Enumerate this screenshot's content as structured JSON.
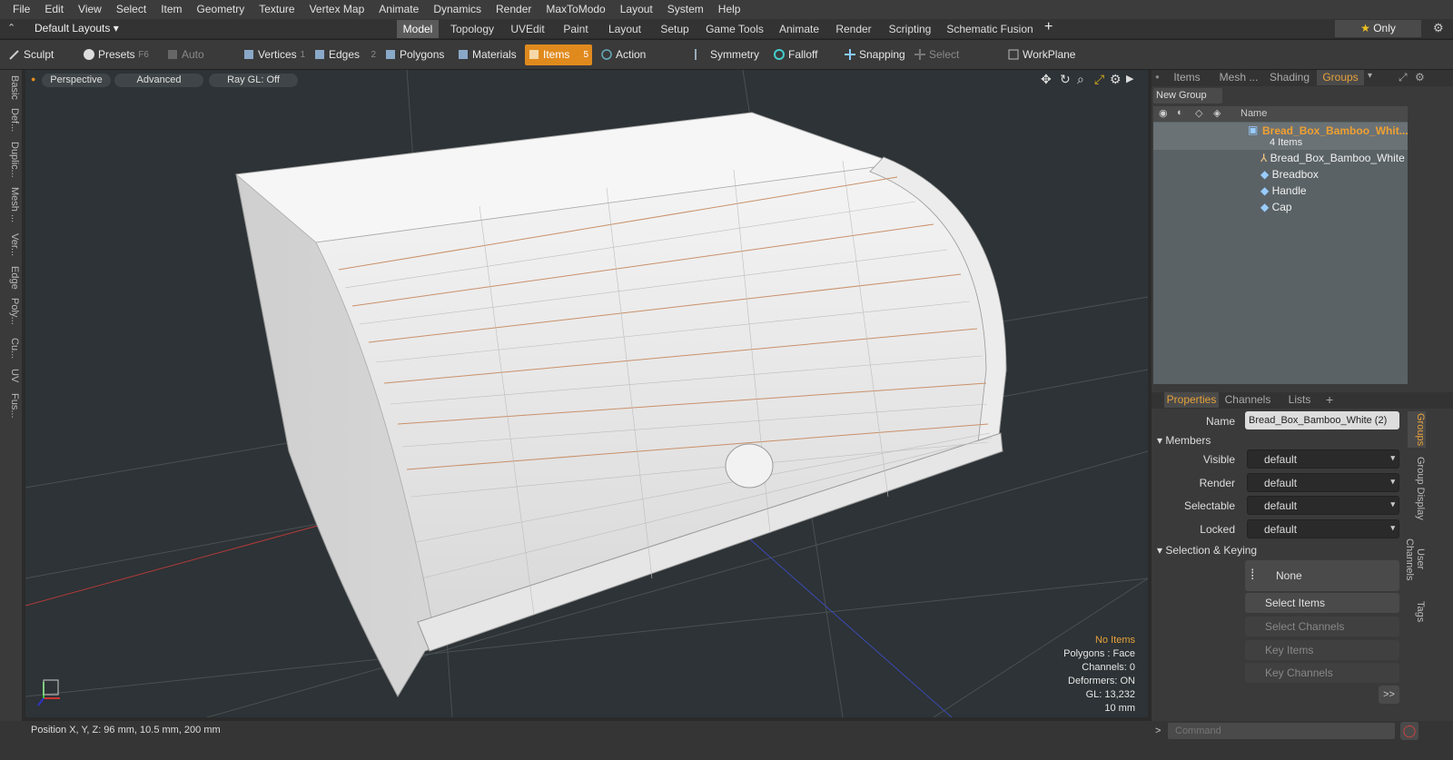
{
  "menubar": {
    "items": [
      "File",
      "Edit",
      "View",
      "Select",
      "Item",
      "Geometry",
      "Texture",
      "Vertex Map",
      "Animate",
      "Dynamics",
      "Render",
      "MaxToModo",
      "Layout",
      "System",
      "Help"
    ]
  },
  "tabbar": {
    "layout_dropdown": "Default Layouts",
    "tabs": [
      "Model",
      "Topology",
      "UVEdit",
      "Paint",
      "Layout",
      "Setup",
      "Game Tools",
      "Animate",
      "Render",
      "Scripting",
      "Schematic Fusion"
    ],
    "only_label": "Only"
  },
  "toolbar": {
    "sculpt": "Sculpt",
    "presets": "Presets",
    "presets_key": "F6",
    "auto_select": "Auto Select",
    "vertices": "Vertices",
    "vertices_key": "1",
    "edges": "Edges",
    "edges_key": "2",
    "polygons": "Polygons",
    "materials": "Materials",
    "items": "Items",
    "items_key": "5",
    "action_center": "Action Center",
    "symmetry": "Symmetry",
    "falloff": "Falloff",
    "snapping": "Snapping",
    "select_through": "Select Through",
    "workplane": "WorkPlane"
  },
  "lefttabs": [
    "Basic",
    "Def...",
    "Duplic...",
    "Mesh ...",
    "Ver...",
    "Edge",
    "Poly...",
    "Cu...",
    "UV",
    "Fus..."
  ],
  "viewport": {
    "perspective": "Perspective",
    "advanced": "Advanced",
    "raygl": "Ray GL: Off",
    "stats": {
      "no_items": "No Items",
      "polygons": "Polygons : Face",
      "channels": "Channels: 0",
      "deformers": "Deformers: ON",
      "gl": "GL: 13,232",
      "size": "10 mm"
    }
  },
  "rightpanel": {
    "top_tabs": [
      "Items",
      "Mesh ...",
      "Shading",
      "Groups"
    ],
    "new_group": "New Group",
    "col_name": "Name",
    "tree": {
      "group_name": "Bread_Box_Bamboo_Whit...",
      "group_count": "4 Items",
      "children": [
        "Bread_Box_Bamboo_White",
        "Breadbox",
        "Handle",
        "Cap"
      ]
    },
    "prop_tabs": [
      "Properties",
      "Channels",
      "Lists"
    ],
    "props": {
      "name_label": "Name",
      "name_value": "Bread_Box_Bamboo_White (2)",
      "members": "Members",
      "visible": "Visible",
      "render": "Render",
      "selectable": "Selectable",
      "locked": "Locked",
      "default": "default",
      "sel_keying": "Selection & Keying",
      "none": "None",
      "select_items": "Select Items",
      "select_channels": "Select Channels",
      "key_items": "Key Items",
      "key_channels": "Key Channels"
    },
    "side_tabs": [
      "Groups",
      "Group Display",
      "User Channels",
      "Tags"
    ]
  },
  "statusbar": {
    "position": "Position X, Y, Z:  96 mm, 10.5 mm, 200 mm",
    "command_placeholder": "Command"
  },
  "colors": {
    "accent": "#e08a1e",
    "bg": "#2d3336"
  }
}
